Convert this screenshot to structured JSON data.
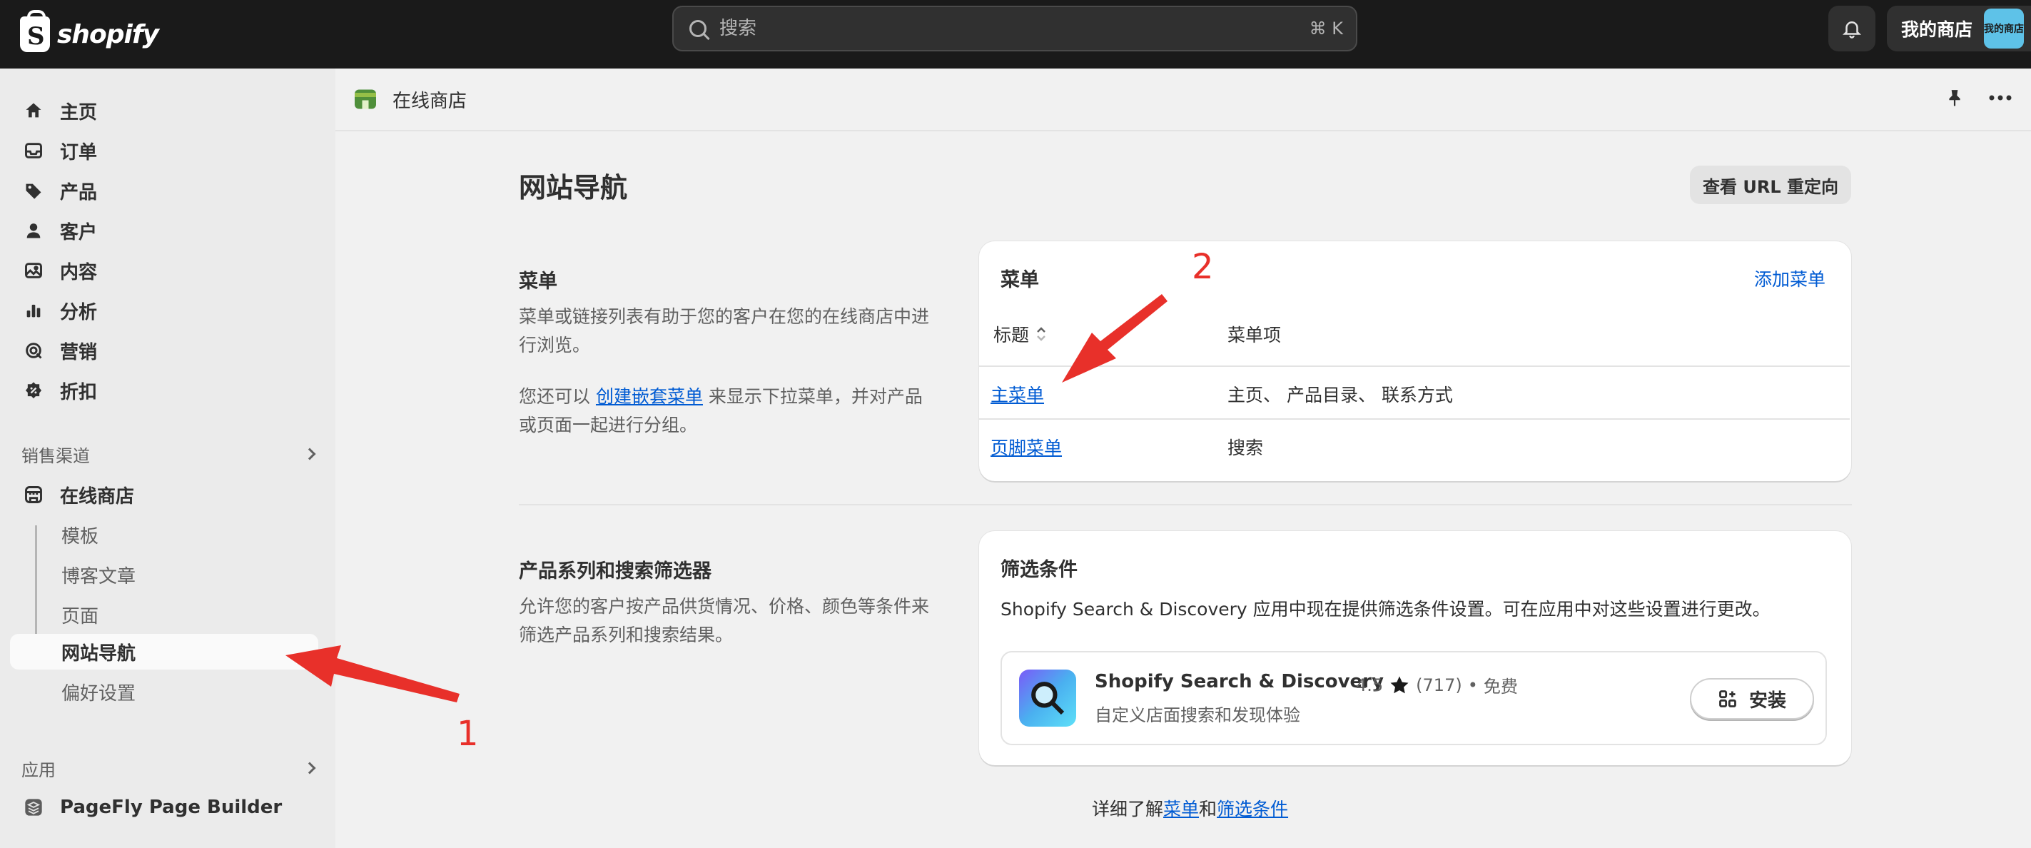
{
  "topbar": {
    "logo_text": "shopify",
    "logo_glyph": "S",
    "search_placeholder": "搜索",
    "search_shortcut": "⌘ K",
    "store_name": "我的商店",
    "store_avatar_text": "我的商店",
    "accent": "#1a1a1a"
  },
  "sidebar": {
    "main_items": [
      {
        "label": "主页",
        "icon": "home-icon"
      },
      {
        "label": "订单",
        "icon": "inbox-icon"
      },
      {
        "label": "产品",
        "icon": "tag-icon"
      },
      {
        "label": "客户",
        "icon": "person-icon"
      },
      {
        "label": "内容",
        "icon": "image-icon"
      },
      {
        "label": "分析",
        "icon": "bar-chart-icon"
      },
      {
        "label": "营销",
        "icon": "target-icon"
      },
      {
        "label": "折扣",
        "icon": "discount-icon"
      }
    ],
    "sales_channels_heading": "销售渠道",
    "online_store_label": "在线商店",
    "online_store_sub": [
      "模板",
      "博客文章",
      "页面",
      "网站导航",
      "偏好设置"
    ],
    "active_sub": "网站导航",
    "apps_heading": "应用",
    "app_item": "PageFly Page Builder"
  },
  "page_strip": {
    "title": "在线商店"
  },
  "main": {
    "title": "网站导航",
    "redirect_button": "查看 URL 重定向",
    "menus_section": {
      "title": "菜单",
      "desc_1": "菜单或链接列表有助于您的客户在您的在线商店中进行浏览。",
      "desc_2_prefix": "您还可以 ",
      "desc_2_link": "创建嵌套菜单",
      "desc_2_suffix": " 来显示下拉菜单，并对产品或页面一起进行分组。"
    },
    "menus_card": {
      "title": "菜单",
      "add_link": "添加菜单",
      "col_title": "标题",
      "col_items": "菜单项",
      "rows": [
        {
          "title": "主菜单",
          "items": "主页、 产品目录、 联系方式"
        },
        {
          "title": "页脚菜单",
          "items": "搜索"
        }
      ]
    },
    "filters_section": {
      "title": "产品系列和搜索筛选器",
      "desc": "允许您的客户按产品供货情况、价格、颜色等条件来筛选产品系列和搜索结果。"
    },
    "filters_card": {
      "title": "筛选条件",
      "desc": "Shopify Search & Discovery 应用中现在提供筛选条件设置。可在应用中对这些设置进行更改。",
      "app": {
        "name": "Shopify Search & Discovery",
        "rating": "4.5",
        "reviews": "(717)",
        "bullet": "•",
        "price": "免费",
        "subtitle": "自定义店面搜索和发现体验",
        "install": "安装"
      }
    },
    "footer": {
      "prefix": "详细了解",
      "link_1": "菜单",
      "middle": "和",
      "link_2": "筛选条件"
    }
  },
  "annotations": {
    "label_1": "1",
    "label_2": "2",
    "color": "#e8302a"
  }
}
